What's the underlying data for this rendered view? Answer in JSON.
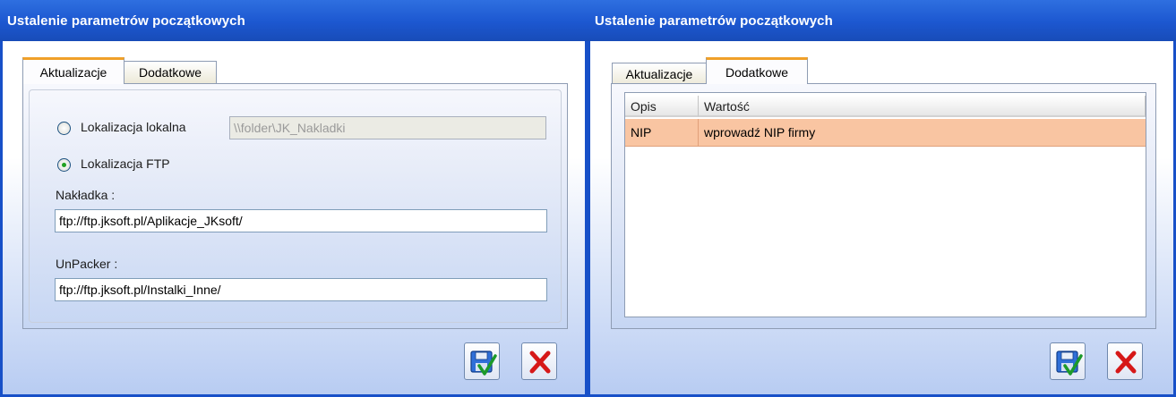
{
  "left_dialog": {
    "title": "Ustalenie parametrów początkowych",
    "tabs": [
      {
        "label": "Aktualizacje",
        "active": true
      },
      {
        "label": "Dodatkowe",
        "active": false
      }
    ],
    "local_location": {
      "label": "Lokalizacja lokalna",
      "checked": false,
      "path": "\\\\folder\\JK_Nakladki"
    },
    "ftp_location": {
      "label": "Lokalizacja FTP",
      "checked": true
    },
    "overlay": {
      "label": "Nakładka :",
      "value": "ftp://ftp.jksoft.pl/Aplikacje_JKsoft/"
    },
    "unpacker": {
      "label": "UnPacker :",
      "value": "ftp://ftp.jksoft.pl/Instalki_Inne/"
    },
    "buttons": {
      "save": "save-icon",
      "cancel": "close-icon"
    }
  },
  "right_dialog": {
    "title": "Ustalenie parametrów początkowych",
    "tabs": [
      {
        "label": "Aktualizacje",
        "active": false
      },
      {
        "label": "Dodatkowe",
        "active": true
      }
    ],
    "table": {
      "columns": [
        "Opis",
        "Wartość"
      ],
      "rows": [
        {
          "opis": "NIP",
          "wartosc": "wprowadź NIP firmy",
          "selected": true
        }
      ]
    },
    "buttons": {
      "save": "save-icon",
      "cancel": "close-icon"
    }
  },
  "colors": {
    "title_bar": "#1c57d0",
    "active_tab_accent": "#f0a028",
    "selected_row": "#f9c5a2",
    "radio_dot": "#21a121"
  }
}
